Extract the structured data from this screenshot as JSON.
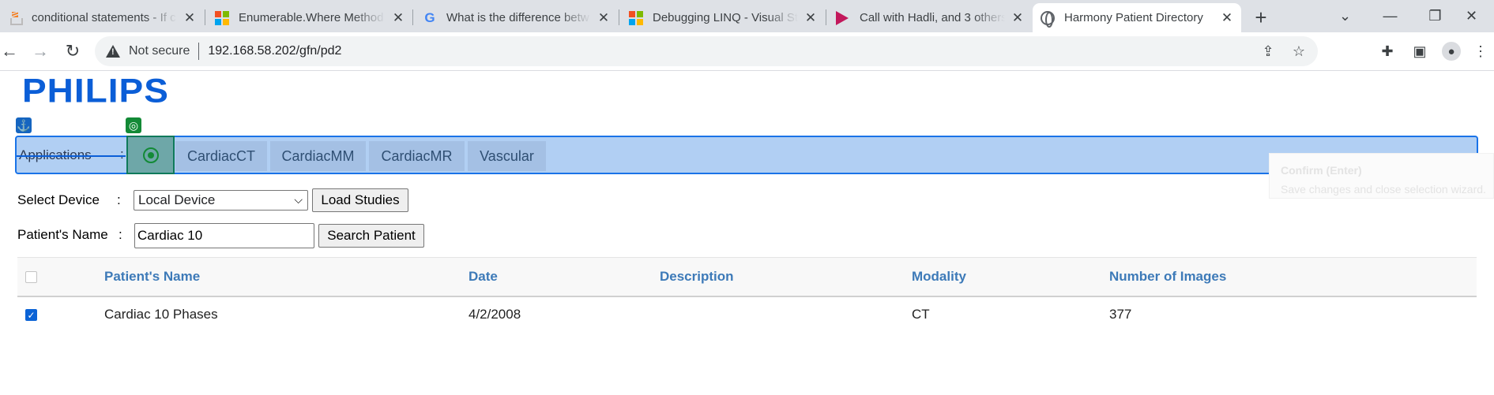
{
  "browser": {
    "tabs": [
      {
        "title": "conditional statements - If c",
        "icon": "stackoverflow-icon",
        "active": false
      },
      {
        "title": "Enumerable.Where Method",
        "icon": "microsoft-icon",
        "active": false
      },
      {
        "title": "What is the difference betw",
        "icon": "google-icon",
        "active": false
      },
      {
        "title": "Debugging LINQ - Visual Stu",
        "icon": "microsoft-icon",
        "active": false
      },
      {
        "title": "Call with Hadli, and 3 others",
        "icon": "stream-play-icon",
        "active": false
      },
      {
        "title": "Harmony Patient Directory",
        "icon": "globe-icon",
        "active": true
      }
    ],
    "security_label": "Not secure",
    "url": "192.168.58.202/gfn/pd2"
  },
  "app": {
    "logo": "PHILIPS",
    "brand_color": "#0b5ed7",
    "applications_label": "Applications",
    "applications_colon": ":",
    "app_tabs": [
      "CardiacCT",
      "CardiacMM",
      "CardiacMR",
      "Vascular"
    ]
  },
  "form": {
    "device_label": "Select Device",
    "device_colon": ":",
    "device_value": "Local Device",
    "load_button": "Load Studies",
    "patient_label": "Patient's Name",
    "patient_colon": ":",
    "patient_value": "Cardiac 10",
    "search_button": "Search Patient"
  },
  "tooltip": {
    "title": "Confirm (Enter)",
    "text": "Save changes and close selection wizard."
  },
  "table": {
    "columns": [
      "Patient's Name",
      "Date",
      "Description",
      "Modality",
      "Number of Images"
    ],
    "rows": [
      {
        "checked": true,
        "name": "Cardiac 10 Phases",
        "date": "4/2/2008",
        "description": "",
        "modality": "CT",
        "images": "377"
      }
    ]
  }
}
